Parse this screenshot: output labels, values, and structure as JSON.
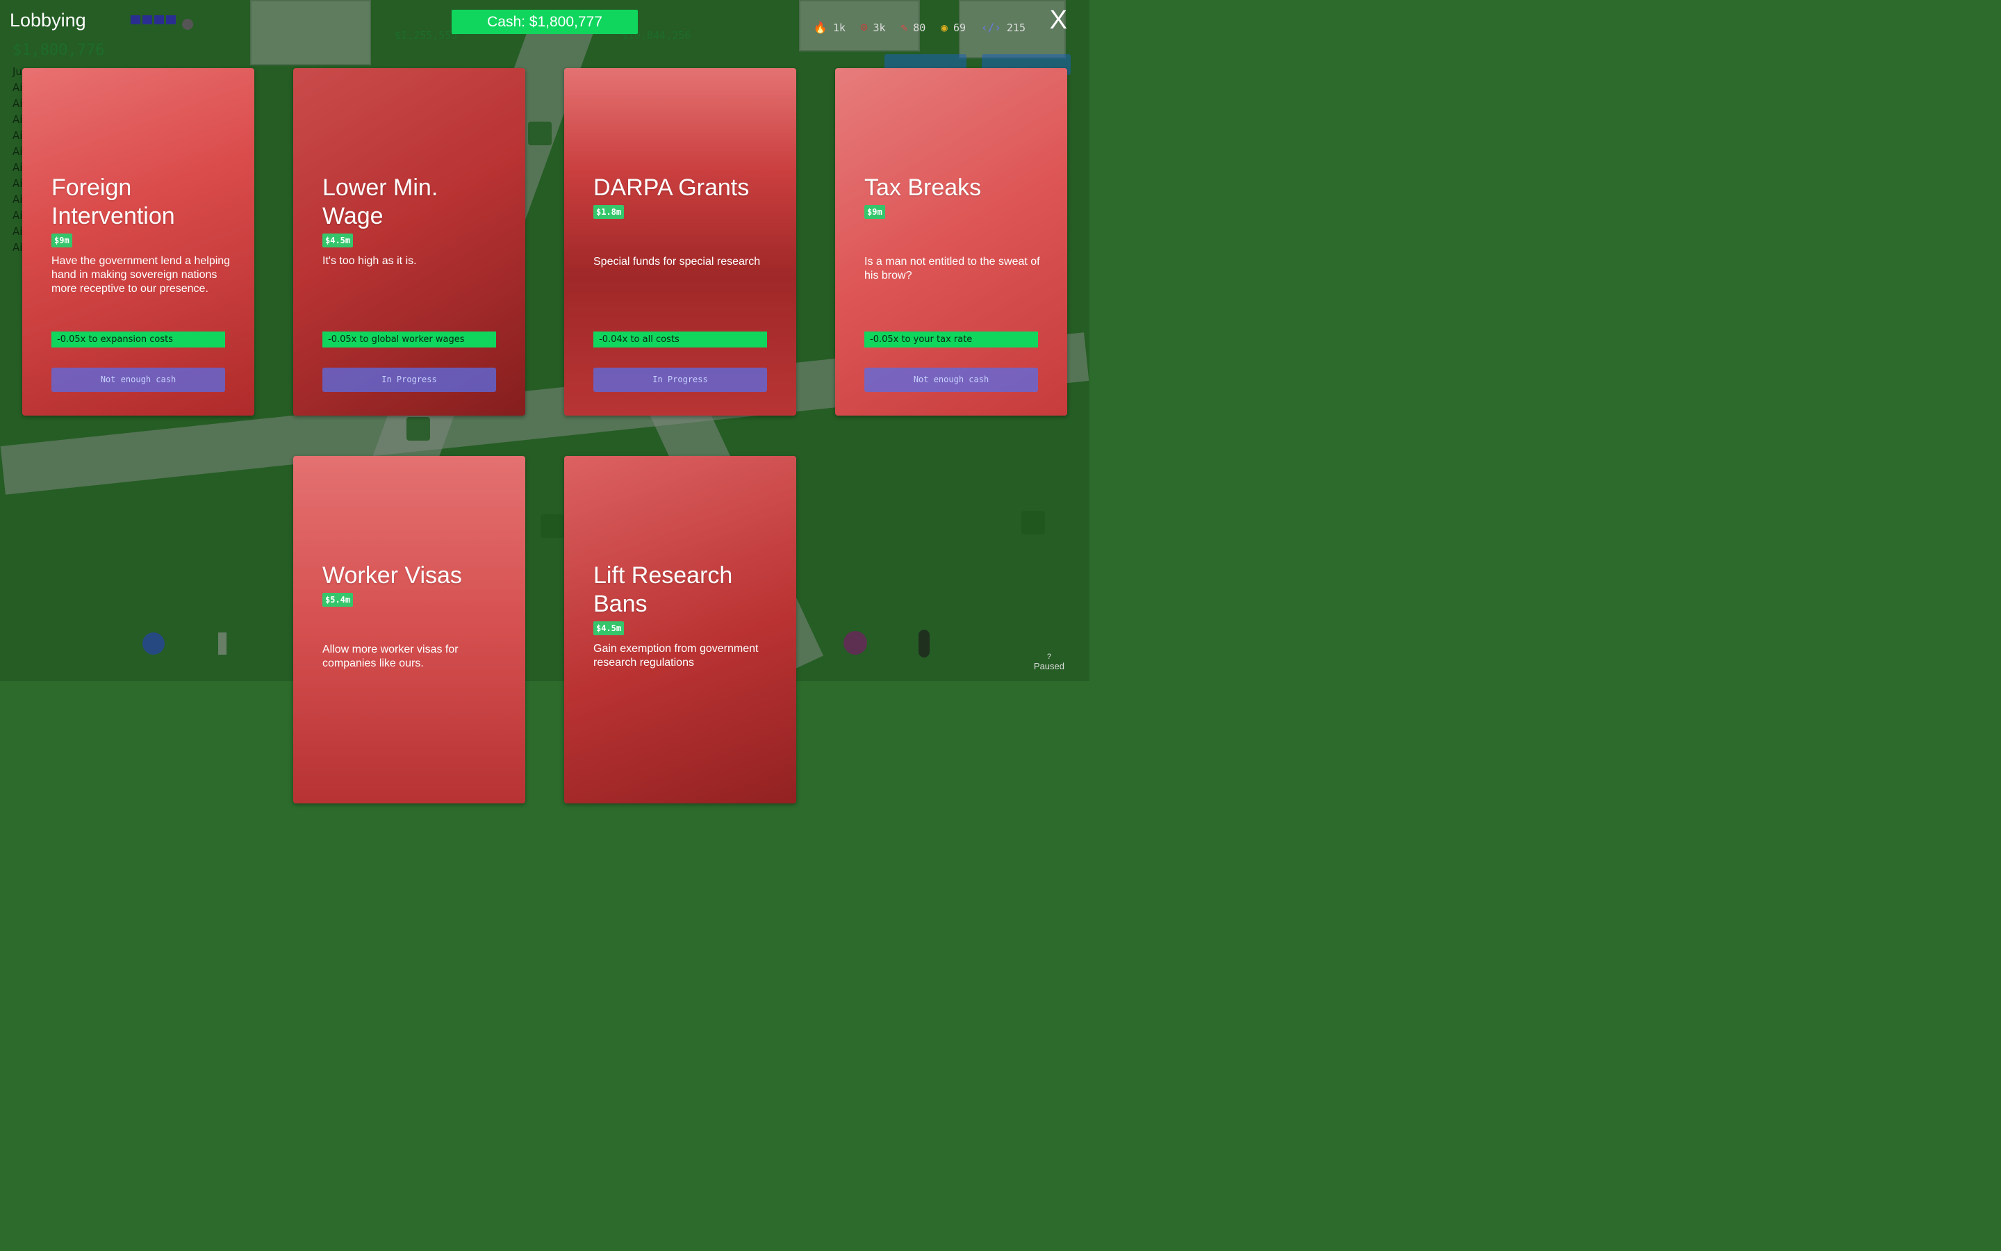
{
  "window": {
    "title": "Lobbying",
    "close_label": "X"
  },
  "cash": {
    "label": "Cash: $1,800,777"
  },
  "stats": [
    {
      "icon": "fire-icon",
      "glyph": "🔥",
      "value": "1k"
    },
    {
      "icon": "angry-face-icon",
      "glyph": "☹",
      "value": "3k"
    },
    {
      "icon": "pen-icon",
      "glyph": "✎",
      "value": "80"
    },
    {
      "icon": "target-icon",
      "glyph": "◉",
      "value": "69"
    },
    {
      "icon": "code-icon",
      "glyph": "‹/›",
      "value": "215"
    }
  ],
  "cards": [
    {
      "title": "Foreign Intervention",
      "price": "$9m",
      "description": "Have the government lend a helping hand in making sovereign nations more receptive to our presence.",
      "effect": "-0.05x to expansion costs",
      "action": "Not enough cash"
    },
    {
      "title": "Lower Min. Wage",
      "price": "$4.5m",
      "description": "It's too high as it is.",
      "effect": "-0.05x to global worker wages",
      "action": "In Progress"
    },
    {
      "title": "DARPA Grants",
      "price": "$1.8m",
      "description": "Special funds for special research",
      "effect": "-0.04x to all costs",
      "action": "In Progress"
    },
    {
      "title": "Tax Breaks",
      "price": "$9m",
      "description": "Is a man not entitled to the sweat of his brow?",
      "effect": "-0.05x to your tax rate",
      "action": "Not enough cash"
    },
    {
      "title": "Worker Visas",
      "price": "$5.4m",
      "description": "Allow more worker visas for companies like ours."
    },
    {
      "title": "Lift Research Bans",
      "price": "$4.5m",
      "description": "Gain exemption from government research regulations"
    }
  ],
  "status": {
    "help": "?",
    "label": "Paused"
  }
}
